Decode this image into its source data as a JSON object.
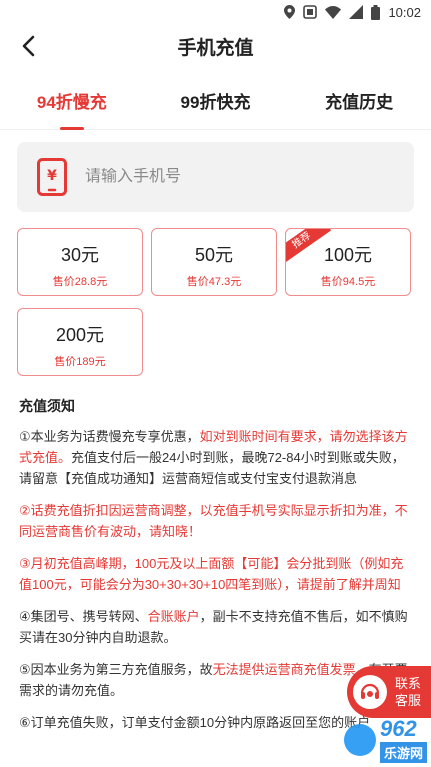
{
  "statusbar": {
    "time": "10:02"
  },
  "header": {
    "title": "手机充值"
  },
  "tabs": [
    {
      "label": "94折慢充",
      "active": true
    },
    {
      "label": "99折快充",
      "active": false
    },
    {
      "label": "充值历史",
      "active": false
    }
  ],
  "phone": {
    "placeholder": "请输入手机号",
    "value": ""
  },
  "cards": [
    {
      "amount": "30元",
      "price": "售价28.8元",
      "tag": ""
    },
    {
      "amount": "50元",
      "price": "售价47.3元",
      "tag": ""
    },
    {
      "amount": "100元",
      "price": "售价94.5元",
      "tag": "推荐"
    },
    {
      "amount": "200元",
      "price": "售价189元",
      "tag": ""
    }
  ],
  "notice": {
    "title": "充值须知",
    "items": [
      {
        "segments": [
          {
            "text": "①本业务为话费慢充专享优惠，",
            "red": false
          },
          {
            "text": "如对到账时间有要求，请勿选择该方式充值。",
            "red": true
          },
          {
            "text": "充值支付后一般24小时到账，最晚72-84小时到账或失败，请留意【充值成功通知】运营商短信或支付宝支付退款消息",
            "red": false
          }
        ]
      },
      {
        "segments": [
          {
            "text": "②话费充值折扣因运营商调整，以充值手机号实际显示折扣为准，不同运营商售价有波动，请知晓！",
            "red": true
          }
        ]
      },
      {
        "segments": [
          {
            "text": "③月初充值高峰期，100元及以上面额【可能】会分批到账（例如充值100元，可能会分为30+30+30+10四笔到账），请提前了解并周知",
            "red": true
          }
        ]
      },
      {
        "segments": [
          {
            "text": "④集团号、携号转网、",
            "red": false
          },
          {
            "text": "合账账户",
            "red": true
          },
          {
            "text": "，副卡不支持充值不售后，如不慎购买请在30分钟内自助退款。",
            "red": false
          }
        ]
      },
      {
        "segments": [
          {
            "text": "⑤因本业务为第三方充值服务，故",
            "red": false
          },
          {
            "text": "无法提供运营商充值发票",
            "red": true
          },
          {
            "text": "，有开票需求的请勿充值。",
            "red": false
          }
        ]
      },
      {
        "segments": [
          {
            "text": "⑥订单充值失败，订单支付金额10分钟内原路返回至您的账户",
            "red": false
          }
        ]
      }
    ]
  },
  "customer_service": {
    "label_line1": "联系",
    "label_line2": "客服"
  },
  "watermark": {
    "text": "962",
    "sub": "乐游网"
  },
  "colors": {
    "accent": "#e53935",
    "card_border": "#f28b8b",
    "input_bg": "#f2f2f2"
  }
}
